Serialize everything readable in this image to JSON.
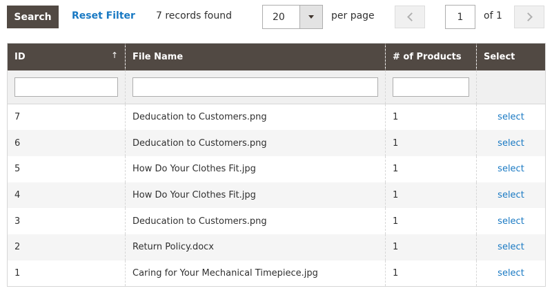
{
  "toolbar": {
    "search_label": "Search",
    "reset_label": "Reset Filter",
    "records_found": "7 records found",
    "per_page_value": "20",
    "per_page_label": "per page",
    "page_current": "1",
    "page_of": "of 1"
  },
  "grid": {
    "columns": {
      "id": "ID",
      "file_name": "File Name",
      "products": "# of Products",
      "select": "Select"
    },
    "sort_indicator": "↑",
    "rows": [
      {
        "id": "7",
        "file_name": "Deducation to Customers.png",
        "products": "1",
        "action": "select"
      },
      {
        "id": "6",
        "file_name": "Deducation to Customers.png",
        "products": "1",
        "action": "select"
      },
      {
        "id": "5",
        "file_name": "How Do Your Clothes Fit.jpg",
        "products": "1",
        "action": "select"
      },
      {
        "id": "4",
        "file_name": "How Do Your Clothes Fit.jpg",
        "products": "1",
        "action": "select"
      },
      {
        "id": "3",
        "file_name": "Deducation to Customers.png",
        "products": "1",
        "action": "select"
      },
      {
        "id": "2",
        "file_name": "Return Policy.docx",
        "products": "1",
        "action": "select"
      },
      {
        "id": "1",
        "file_name": "Caring for Your Mechanical Timepiece.jpg",
        "products": "1",
        "action": "select"
      }
    ]
  },
  "colors": {
    "header_bg": "#514943",
    "link": "#1979c3",
    "stripe": "#f5f5f5"
  }
}
